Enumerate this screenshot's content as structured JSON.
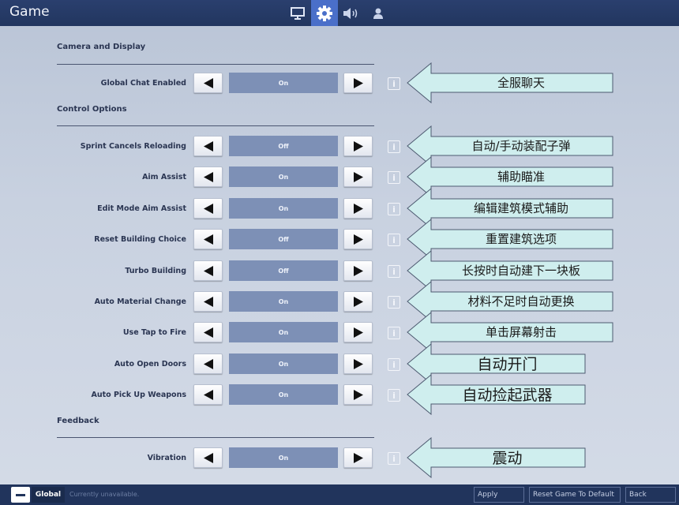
{
  "header": {
    "title": "Game",
    "tabs": [
      {
        "name": "display",
        "icon": "monitor-icon",
        "active": false
      },
      {
        "name": "game",
        "icon": "gear-icon",
        "active": true
      },
      {
        "name": "audio",
        "icon": "speaker-icon",
        "active": false
      },
      {
        "name": "account",
        "icon": "person-icon",
        "active": false
      }
    ]
  },
  "sections": {
    "camera": "Camera and Display",
    "control": "Control Options",
    "feedback": "Feedback"
  },
  "settings": [
    {
      "label": "Global Chat Enabled",
      "value": "On",
      "callout": "全服聊天"
    },
    {
      "label": "Sprint Cancels Reloading",
      "value": "Off",
      "callout": "自动/手动装配子弹"
    },
    {
      "label": "Aim Assist",
      "value": "On",
      "callout": "辅助瞄准"
    },
    {
      "label": "Edit Mode Aim Assist",
      "value": "On",
      "callout": "编辑建筑模式辅助"
    },
    {
      "label": "Reset Building Choice",
      "value": "Off",
      "callout": "重置建筑选项"
    },
    {
      "label": "Turbo Building",
      "value": "Off",
      "callout": "长按时自动建下一块板"
    },
    {
      "label": "Auto Material Change",
      "value": "On",
      "callout": "材料不足时自动更换"
    },
    {
      "label": "Use Tap to Fire",
      "value": "On",
      "callout": "单击屏幕射击"
    },
    {
      "label": "Auto Open Doors",
      "value": "On",
      "callout": "自动开门"
    },
    {
      "label": "Auto Pick Up Weapons",
      "value": "On",
      "callout": "自动捡起武器"
    },
    {
      "label": "Vibration",
      "value": "On",
      "callout": "震动"
    }
  ],
  "footer": {
    "chat_tab": "Global",
    "chat_status": "Currently unavailable.",
    "apply": "Apply",
    "reset": "Reset Game To Default",
    "back": "Back"
  },
  "colors": {
    "header_bg": "#22365f",
    "active_tab": "#4a6fc9",
    "value_box": "#7d90b6",
    "callout_fill": "#cfeeee",
    "callout_stroke": "#4d5a70"
  }
}
